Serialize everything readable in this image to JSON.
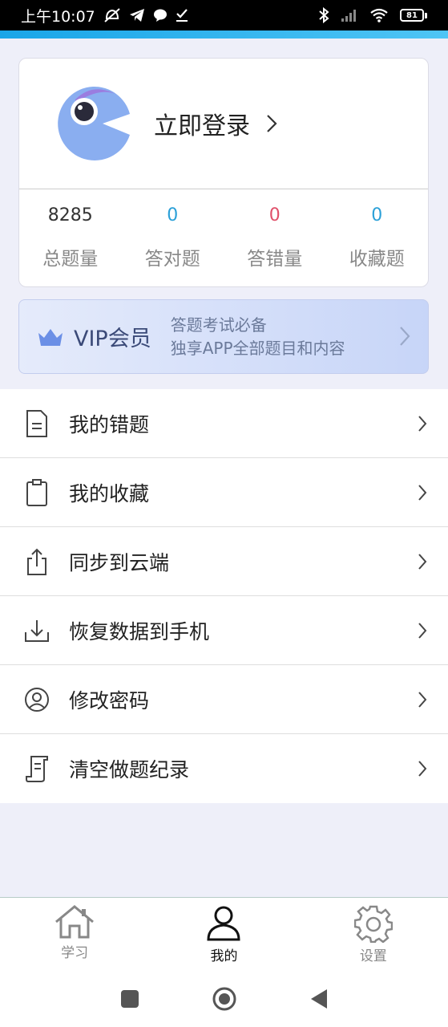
{
  "status_bar": {
    "time": "上午10:07",
    "battery": "81"
  },
  "profile": {
    "login_label": "立即登录",
    "stats": [
      {
        "value": "8285",
        "label": "总题量",
        "color": "#333333"
      },
      {
        "value": "0",
        "label": "答对题",
        "color": "#2ba0d8"
      },
      {
        "value": "0",
        "label": "答错量",
        "color": "#e0506a"
      },
      {
        "value": "0",
        "label": "收藏题",
        "color": "#2ba0d8"
      }
    ]
  },
  "vip": {
    "title": "VIP会员",
    "desc_line1": "答题考试必备",
    "desc_line2": "独享APP全部题目和内容"
  },
  "menu": [
    {
      "label": "我的错题",
      "icon": "document-icon"
    },
    {
      "label": "我的收藏",
      "icon": "clipboard-icon"
    },
    {
      "label": "同步到云端",
      "icon": "upload-icon"
    },
    {
      "label": "恢复数据到手机",
      "icon": "download-icon"
    },
    {
      "label": "修改密码",
      "icon": "user-circle-icon"
    },
    {
      "label": "清空做题纪录",
      "icon": "scroll-icon"
    }
  ],
  "tabs": [
    {
      "label": "学习",
      "icon": "home-icon",
      "active": false
    },
    {
      "label": "我的",
      "icon": "person-icon",
      "active": true
    },
    {
      "label": "设置",
      "icon": "gear-icon",
      "active": false
    }
  ],
  "colors": {
    "accent": "#19a5e8",
    "avatar": "#8aaef0",
    "vip_crown": "#6b8fe6"
  }
}
